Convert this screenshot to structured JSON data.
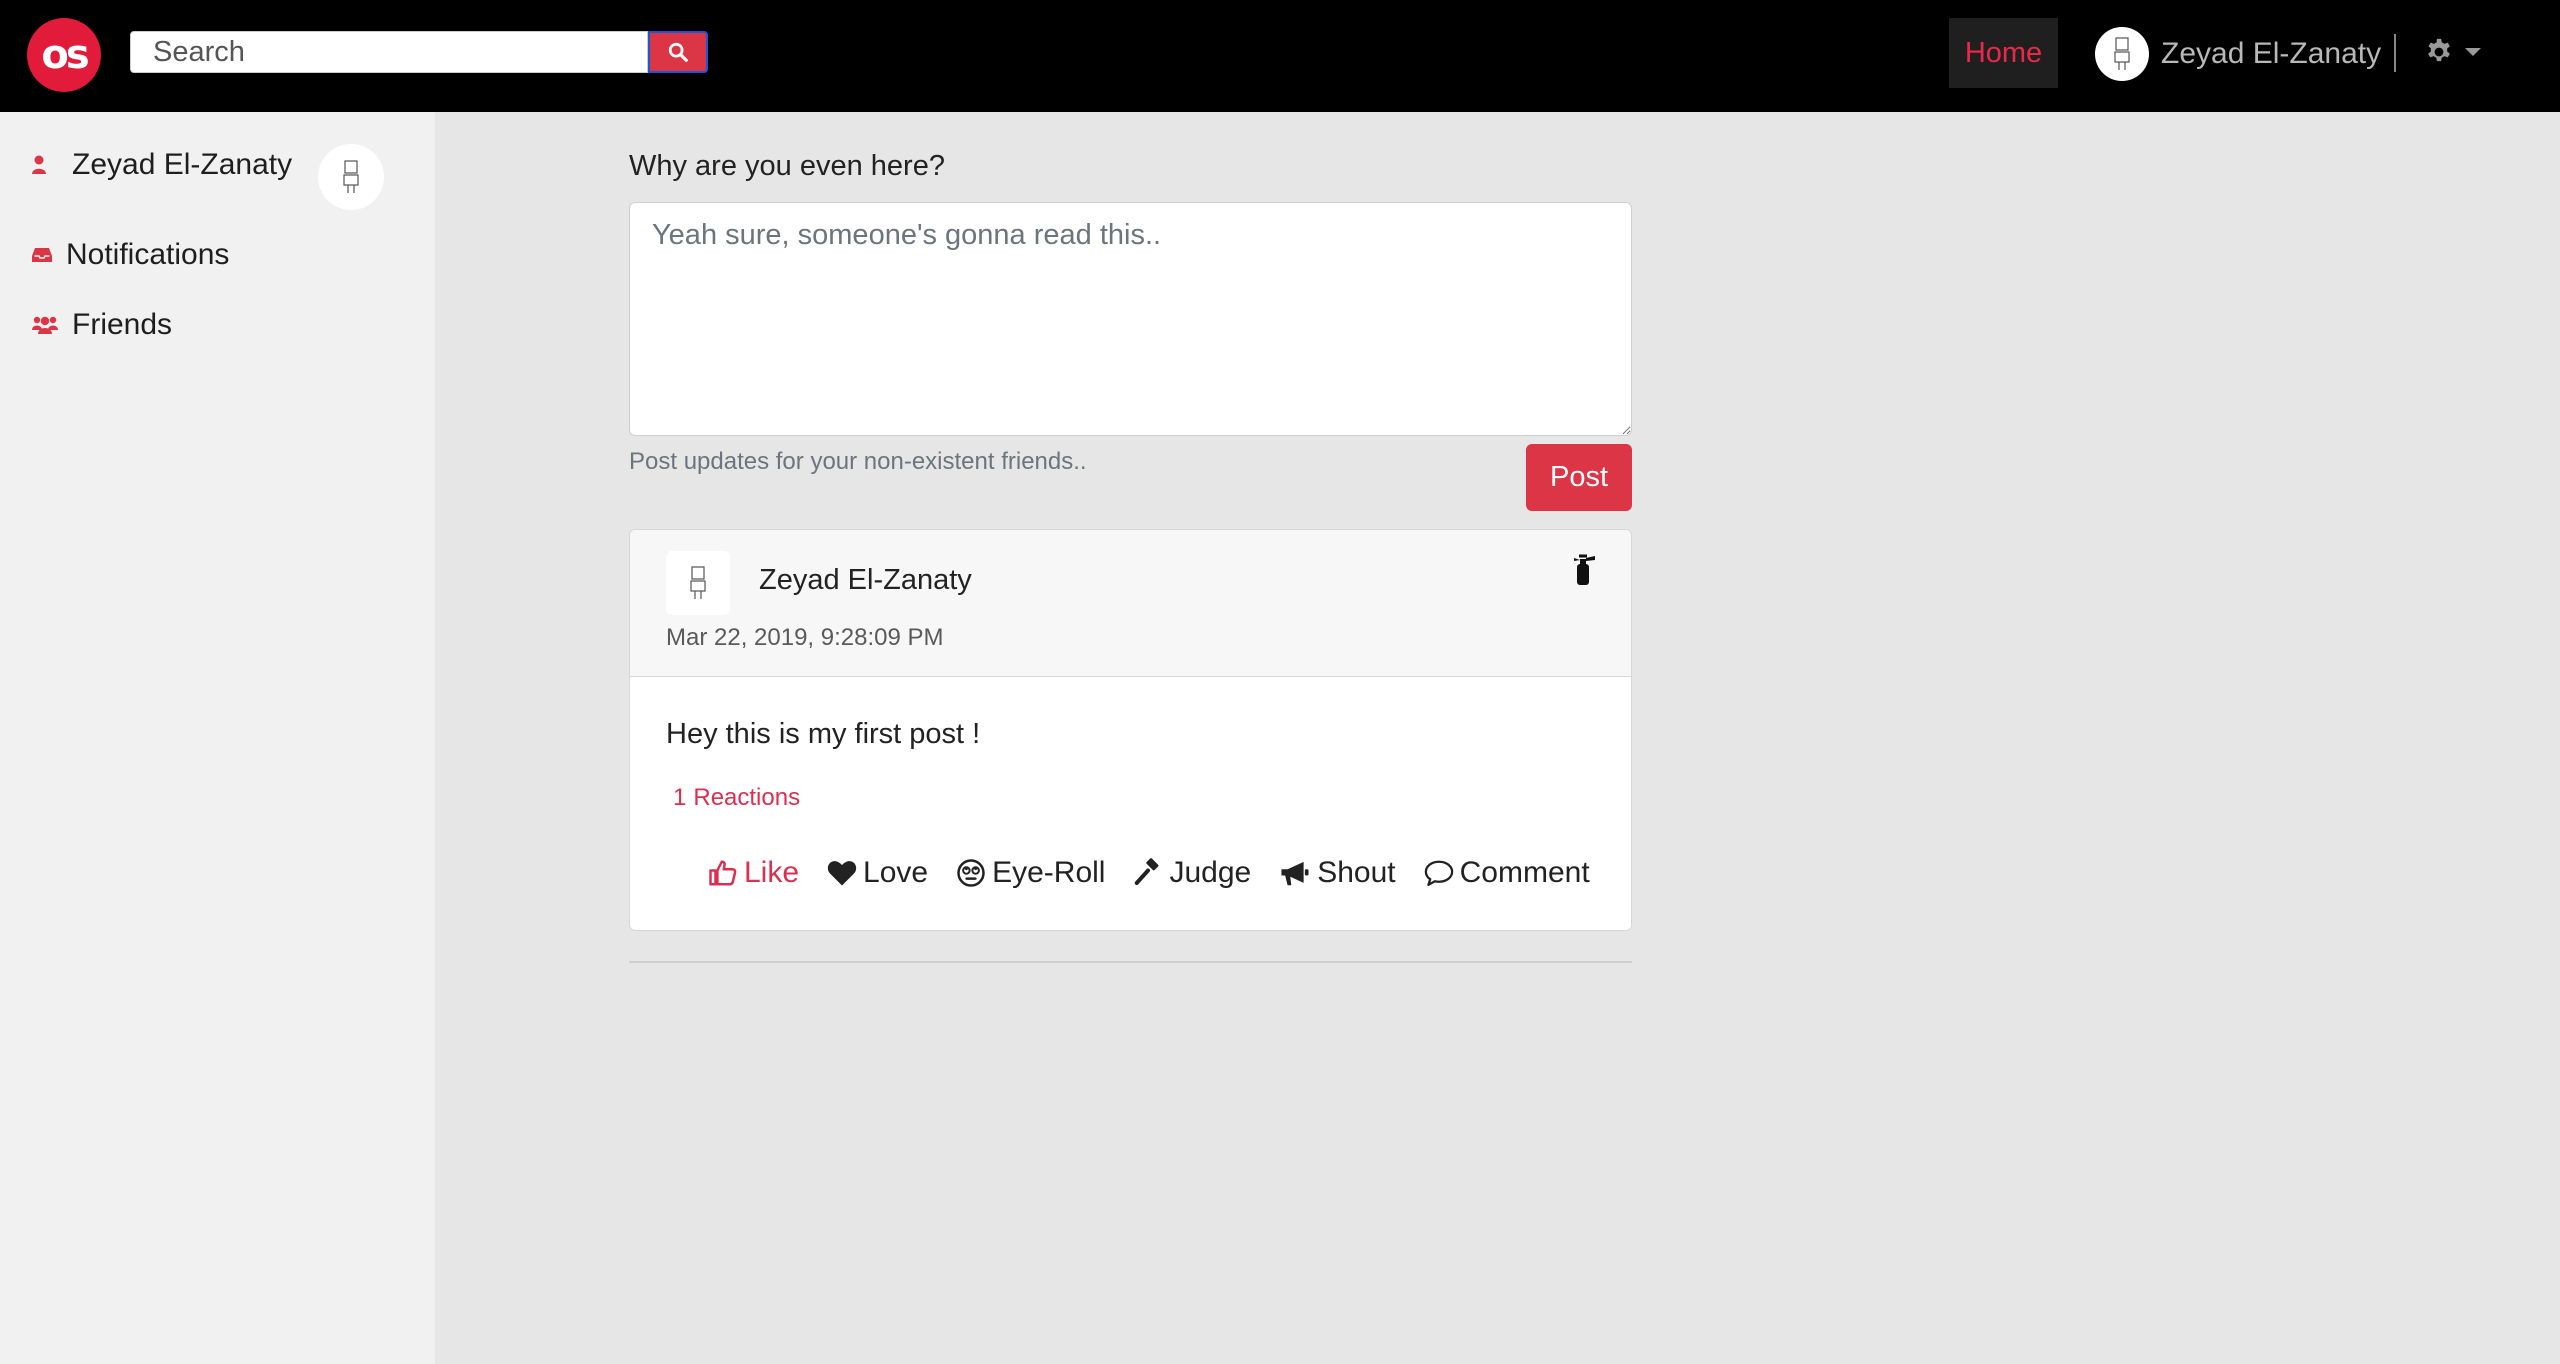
{
  "nav": {
    "logo_text": "os",
    "search_placeholder": "Search",
    "home_label": "Home",
    "user_name": "Zeyad El-Zanaty"
  },
  "sidebar": {
    "profile_name": "Zeyad El-Zanaty",
    "items": [
      {
        "label": "Notifications",
        "icon": "inbox-icon"
      },
      {
        "label": "Friends",
        "icon": "users-icon"
      }
    ]
  },
  "composer": {
    "label": "Why are you even here?",
    "placeholder": "Yeah sure, someone's gonna read this..",
    "help_text": "Post updates for your non-existent friends..",
    "post_label": "Post"
  },
  "post": {
    "author": "Zeyad El-Zanaty",
    "date": "Mar 22, 2019, 9:28:09 PM",
    "text": "Hey this is my first post !",
    "reaction_count": "1",
    "reaction_label": "Reactions",
    "actions": {
      "like": "Like",
      "love": "Love",
      "eyeroll": "Eye-Roll",
      "judge": "Judge",
      "shout": "Shout",
      "comment": "Comment"
    }
  },
  "colors": {
    "accent": "#dc3545",
    "navbar": "#000000",
    "sidebar": "#f1f1f1",
    "background": "#e6e6e6"
  }
}
